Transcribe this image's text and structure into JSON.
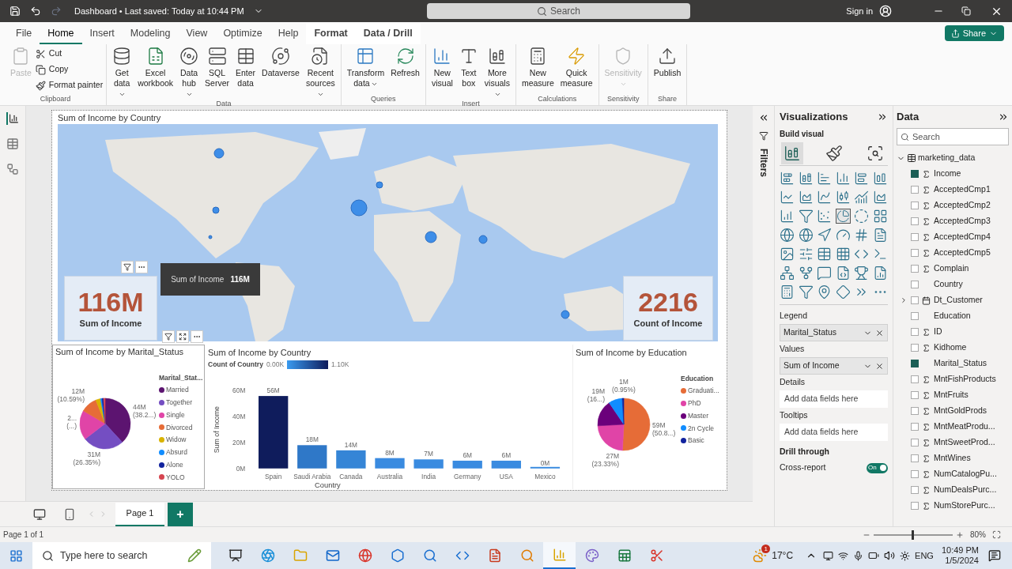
{
  "title_bar": {
    "file_title": "Dashboard • Last saved: Today at 10:44 PM",
    "search_placeholder": "Search",
    "sign_in": "Sign in"
  },
  "menu_tabs": [
    {
      "label": "File",
      "selected": false,
      "kind": "normal"
    },
    {
      "label": "Home",
      "selected": true,
      "kind": "normal"
    },
    {
      "label": "Insert",
      "selected": false,
      "kind": "normal"
    },
    {
      "label": "Modeling",
      "selected": false,
      "kind": "normal"
    },
    {
      "label": "View",
      "selected": false,
      "kind": "normal"
    },
    {
      "label": "Optimize",
      "selected": false,
      "kind": "normal"
    },
    {
      "label": "Help",
      "selected": false,
      "kind": "normal"
    },
    {
      "label": "Format",
      "selected": false,
      "kind": "contextual"
    },
    {
      "label": "Data / Drill",
      "selected": false,
      "kind": "contextual"
    }
  ],
  "share_button": "Share",
  "ribbon_groups": [
    {
      "name": "Clipboard",
      "buttons": [
        {
          "label": "Paste",
          "kind": "paste",
          "disabled": true,
          "dropdown": false
        }
      ],
      "small_buttons": [
        {
          "label": "Cut",
          "kind": "cut",
          "disabled": false
        },
        {
          "label": "Copy",
          "kind": "copy",
          "disabled": false
        },
        {
          "label": "Format painter",
          "kind": "painter",
          "disabled": false
        }
      ]
    },
    {
      "name": "Data",
      "buttons": [
        {
          "label": "Get data",
          "kind": "get_data",
          "disabled": false,
          "dropdown": true
        },
        {
          "label": "Excel workbook",
          "kind": "excel",
          "disabled": false,
          "dropdown": false
        },
        {
          "label": "Data hub",
          "kind": "data_hub",
          "disabled": false,
          "dropdown": true
        },
        {
          "label": "SQL Server",
          "kind": "sql",
          "disabled": false,
          "dropdown": false
        },
        {
          "label": "Enter data",
          "kind": "enter_data",
          "disabled": false,
          "dropdown": false
        },
        {
          "label": "Dataverse",
          "kind": "dataverse",
          "disabled": false,
          "dropdown": false
        },
        {
          "label": "Recent sources",
          "kind": "recent",
          "disabled": false,
          "dropdown": true
        }
      ]
    },
    {
      "name": "Queries",
      "buttons": [
        {
          "label": "Transform data",
          "kind": "transform",
          "disabled": false,
          "dropdown": true
        },
        {
          "label": "Refresh",
          "kind": "refresh",
          "disabled": false,
          "dropdown": false
        }
      ]
    },
    {
      "name": "Insert",
      "buttons": [
        {
          "label": "New visual",
          "kind": "new_visual",
          "disabled": false,
          "dropdown": false
        },
        {
          "label": "Text box",
          "kind": "text_box",
          "disabled": false,
          "dropdown": false
        },
        {
          "label": "More visuals",
          "kind": "more_visuals",
          "disabled": false,
          "dropdown": true
        }
      ]
    },
    {
      "name": "Calculations",
      "buttons": [
        {
          "label": "New measure",
          "kind": "new_measure",
          "disabled": false,
          "dropdown": false
        },
        {
          "label": "Quick measure",
          "kind": "quick_measure",
          "disabled": false,
          "dropdown": false
        }
      ]
    },
    {
      "name": "Sensitivity",
      "buttons": [
        {
          "label": "Sensitivity",
          "kind": "sensitivity",
          "disabled": true,
          "dropdown": true
        }
      ]
    },
    {
      "name": "Share",
      "buttons": [
        {
          "label": "Publish",
          "kind": "publish",
          "disabled": false,
          "dropdown": false
        }
      ]
    }
  ],
  "left_nav": [
    {
      "kind": "report",
      "selected": true
    },
    {
      "kind": "table",
      "selected": false
    },
    {
      "kind": "model",
      "selected": false
    }
  ],
  "report": {
    "map": {
      "title": "Sum of Income by Country"
    },
    "cards": [
      {
        "value": "116M",
        "label": "Sum of Income"
      },
      {
        "value": "2216",
        "label": "Count of Income"
      }
    ],
    "tooltip": {
      "label": "Sum of Income",
      "value": "116M"
    },
    "marital_pie": {
      "slice_labels": [
        {
          "value": "12M",
          "share": "(10.59%)"
        },
        {
          "value": "44M",
          "share": "(38.2...)"
        },
        {
          "value": "2...",
          "share": "(...)"
        },
        {
          "value": "31M",
          "share": "(26.35%)"
        }
      ],
      "legend": {
        "title": "Marital_Stat...",
        "items": [
          {
            "color": "#5c1470"
          },
          {
            "color": "#744ec2"
          },
          {
            "color": "#e044a7"
          },
          {
            "color": "#e66c37"
          },
          {
            "color": "#d9b300"
          },
          {
            "color": "#118dff"
          },
          {
            "color": "#12239e"
          },
          {
            "color": "#d64550"
          }
        ]
      },
      "chart_data": {
        "type": "pie",
        "title": "Sum of Income by Marital_Status",
        "categories": [
          "Married",
          "Together",
          "Single",
          "Divorced",
          "Widow",
          "Absurd",
          "Alone",
          "YOLO"
        ],
        "values": [
          38.2,
          26.35,
          18.86,
          10.59,
          3.0,
          1.0,
          1.0,
          1.0
        ],
        "legend": "right"
      }
    },
    "country_bar": {
      "color_scale": {
        "title": "Count of Country",
        "min": "0.00K",
        "max": "1.10K"
      },
      "bars": [
        {
          "color": "#0f1c5c"
        },
        {
          "color": "#2f78c8"
        },
        {
          "color": "#3585d6"
        },
        {
          "color": "#3a8be0"
        },
        {
          "color": "#3a8be0"
        },
        {
          "color": "#3a8be0"
        },
        {
          "color": "#3a8be0"
        },
        {
          "color": "#3a8be0"
        }
      ],
      "chart_data": {
        "type": "bar",
        "title": "Sum of Income by Country",
        "xlabel": "Country",
        "ylabel": "Sum of Income",
        "categories": [
          "Spain",
          "Saudi Arabia",
          "Canada",
          "Australia",
          "India",
          "Germany",
          "USA",
          "Mexico"
        ],
        "values": [
          56,
          18,
          14,
          8,
          7,
          6,
          6,
          0
        ],
        "ylim": [
          0,
          60
        ],
        "yticks": [
          {
            "value": 0,
            "label": "0M"
          },
          {
            "value": 20,
            "label": "20M"
          },
          {
            "value": 40,
            "label": "40M"
          },
          {
            "value": 60,
            "label": "60M"
          }
        ],
        "value_labels": [
          "56M",
          "18M",
          "14M",
          "8M",
          "7M",
          "6M",
          "6M",
          "0M"
        ]
      }
    },
    "education_pie": {
      "slice_labels": [
        {
          "value": "1M",
          "share": "(0.95%)"
        },
        {
          "value": "19M",
          "share": "(16...)"
        },
        {
          "value": "59M",
          "share": "(50.8...)"
        },
        {
          "value": "27M",
          "share": "(23.33%)"
        }
      ],
      "legend": {
        "title": "Education",
        "items": [
          {
            "color": "#e66c37"
          },
          {
            "color": "#e044a7"
          },
          {
            "color": "#6b007b"
          },
          {
            "color": "#118dff"
          },
          {
            "color": "#12239e"
          }
        ]
      },
      "chart_data": {
        "type": "pie",
        "title": "Sum of Income by Education",
        "categories": [
          "Graduati...",
          "PhD",
          "Master",
          "2n Cycle",
          "Basic"
        ],
        "values": [
          50.8,
          23.33,
          16.4,
          8.52,
          0.95
        ],
        "legend": "right"
      }
    }
  },
  "page_tabs": [
    {
      "label": "Page 1",
      "selected": true
    }
  ],
  "add_page": "+",
  "filters_label": "Filters",
  "visualizations": {
    "title": "Visualizations",
    "build_label": "Build visual",
    "build_tabs": [
      {
        "kind": "build",
        "selected": true
      },
      {
        "kind": "format",
        "selected": false
      },
      {
        "kind": "analytics",
        "selected": false
      }
    ],
    "gallery": [
      {
        "selected": false
      },
      {
        "selected": false
      },
      {
        "selected": false
      },
      {
        "selected": false
      },
      {
        "selected": false
      },
      {
        "selected": false
      },
      {
        "selected": false
      },
      {
        "selected": false
      },
      {
        "selected": false
      },
      {
        "selected": false
      },
      {
        "selected": false
      },
      {
        "selected": false
      },
      {
        "selected": false
      },
      {
        "selected": false
      },
      {
        "selected": false
      },
      {
        "selected": true
      },
      {
        "selected": false
      },
      {
        "selected": false
      },
      {
        "selected": false
      },
      {
        "selected": false
      },
      {
        "selected": false
      },
      {
        "selected": false
      },
      {
        "selected": false
      },
      {
        "selected": false
      },
      {
        "selected": false
      },
      {
        "selected": false
      },
      {
        "selected": false
      },
      {
        "selected": false
      },
      {
        "selected": false
      },
      {
        "selected": false
      },
      {
        "selected": false
      },
      {
        "selected": false
      },
      {
        "selected": false
      },
      {
        "selected": false
      },
      {
        "selected": false
      },
      {
        "selected": false
      },
      {
        "selected": false
      },
      {
        "selected": false
      },
      {
        "selected": false
      },
      {
        "selected": false
      },
      {
        "selected": false
      },
      {
        "selected": false
      }
    ],
    "wells": [
      {
        "label": "Legend",
        "value": "Marital_Status"
      },
      {
        "label": "Values",
        "value": "Sum of Income"
      },
      {
        "label": "Details",
        "placeholder": "Add data fields here"
      },
      {
        "label": "Tooltips",
        "placeholder": "Add data fields here"
      }
    ],
    "drill_through": {
      "title": "Drill through",
      "cross_report": {
        "label": "Cross-report",
        "on": true,
        "state_text": "On"
      }
    }
  },
  "data_pane": {
    "title": "Data",
    "search_placeholder": "Search",
    "tree": [
      {
        "name": "marketing_data",
        "kind": "table",
        "expanded": true,
        "children": [
          {
            "name": "Income",
            "kind": "sum",
            "checked": true
          },
          {
            "name": "AcceptedCmp1",
            "kind": "sum",
            "checked": false
          },
          {
            "name": "AcceptedCmp2",
            "kind": "sum",
            "checked": false
          },
          {
            "name": "AcceptedCmp3",
            "kind": "sum",
            "checked": false
          },
          {
            "name": "AcceptedCmp4",
            "kind": "sum",
            "checked": false
          },
          {
            "name": "AcceptedCmp5",
            "kind": "sum",
            "checked": false
          },
          {
            "name": "Complain",
            "kind": "sum",
            "checked": false
          },
          {
            "name": "Country",
            "kind": "text",
            "checked": false
          },
          {
            "name": "Dt_Customer",
            "kind": "date",
            "checked": false,
            "expanded": false
          },
          {
            "name": "Education",
            "kind": "text",
            "checked": false
          },
          {
            "name": "ID",
            "kind": "sum",
            "checked": false
          },
          {
            "name": "Kidhome",
            "kind": "sum",
            "checked": false
          },
          {
            "name": "Marital_Status",
            "kind": "text",
            "checked": true
          },
          {
            "name": "MntFishProducts",
            "kind": "sum",
            "checked": false
          },
          {
            "name": "MntFruits",
            "kind": "sum",
            "checked": false
          },
          {
            "name": "MntGoldProds",
            "kind": "sum",
            "checked": false
          },
          {
            "name": "MntMeatProdu...",
            "kind": "sum",
            "checked": false
          },
          {
            "name": "MntSweetProd...",
            "kind": "sum",
            "checked": false
          },
          {
            "name": "MntWines",
            "kind": "sum",
            "checked": false
          },
          {
            "name": "NumCatalogPu...",
            "kind": "sum",
            "checked": false
          },
          {
            "name": "NumDealsPurc...",
            "kind": "sum",
            "checked": false
          },
          {
            "name": "NumStorePurc...",
            "kind": "sum",
            "checked": false
          }
        ]
      }
    ]
  },
  "status_bar": {
    "page_info": "Page 1 of 1",
    "zoom": {
      "level": 0.5,
      "value": "80%"
    }
  },
  "taskbar": {
    "search_placeholder": "Type here to search",
    "apps": [
      {
        "kind": "taskview",
        "selected": false
      },
      {
        "kind": "edge",
        "selected": false
      },
      {
        "kind": "folder",
        "selected": false
      },
      {
        "kind": "mail",
        "selected": false
      },
      {
        "kind": "browser",
        "selected": false
      },
      {
        "kind": "hex",
        "selected": false
      },
      {
        "kind": "magnifier",
        "selected": false
      },
      {
        "kind": "c",
        "selected": false
      },
      {
        "kind": "slides",
        "selected": false
      },
      {
        "kind": "search",
        "selected": false
      },
      {
        "kind": "powerbi",
        "selected": true
      },
      {
        "kind": "paint",
        "selected": false
      },
      {
        "kind": "excel",
        "selected": false
      },
      {
        "kind": "snip",
        "selected": false
      }
    ],
    "weather_badge": "1",
    "temperature": "17°C",
    "language": "ENG",
    "time": "10:49 PM",
    "date": "1/5/2024"
  }
}
